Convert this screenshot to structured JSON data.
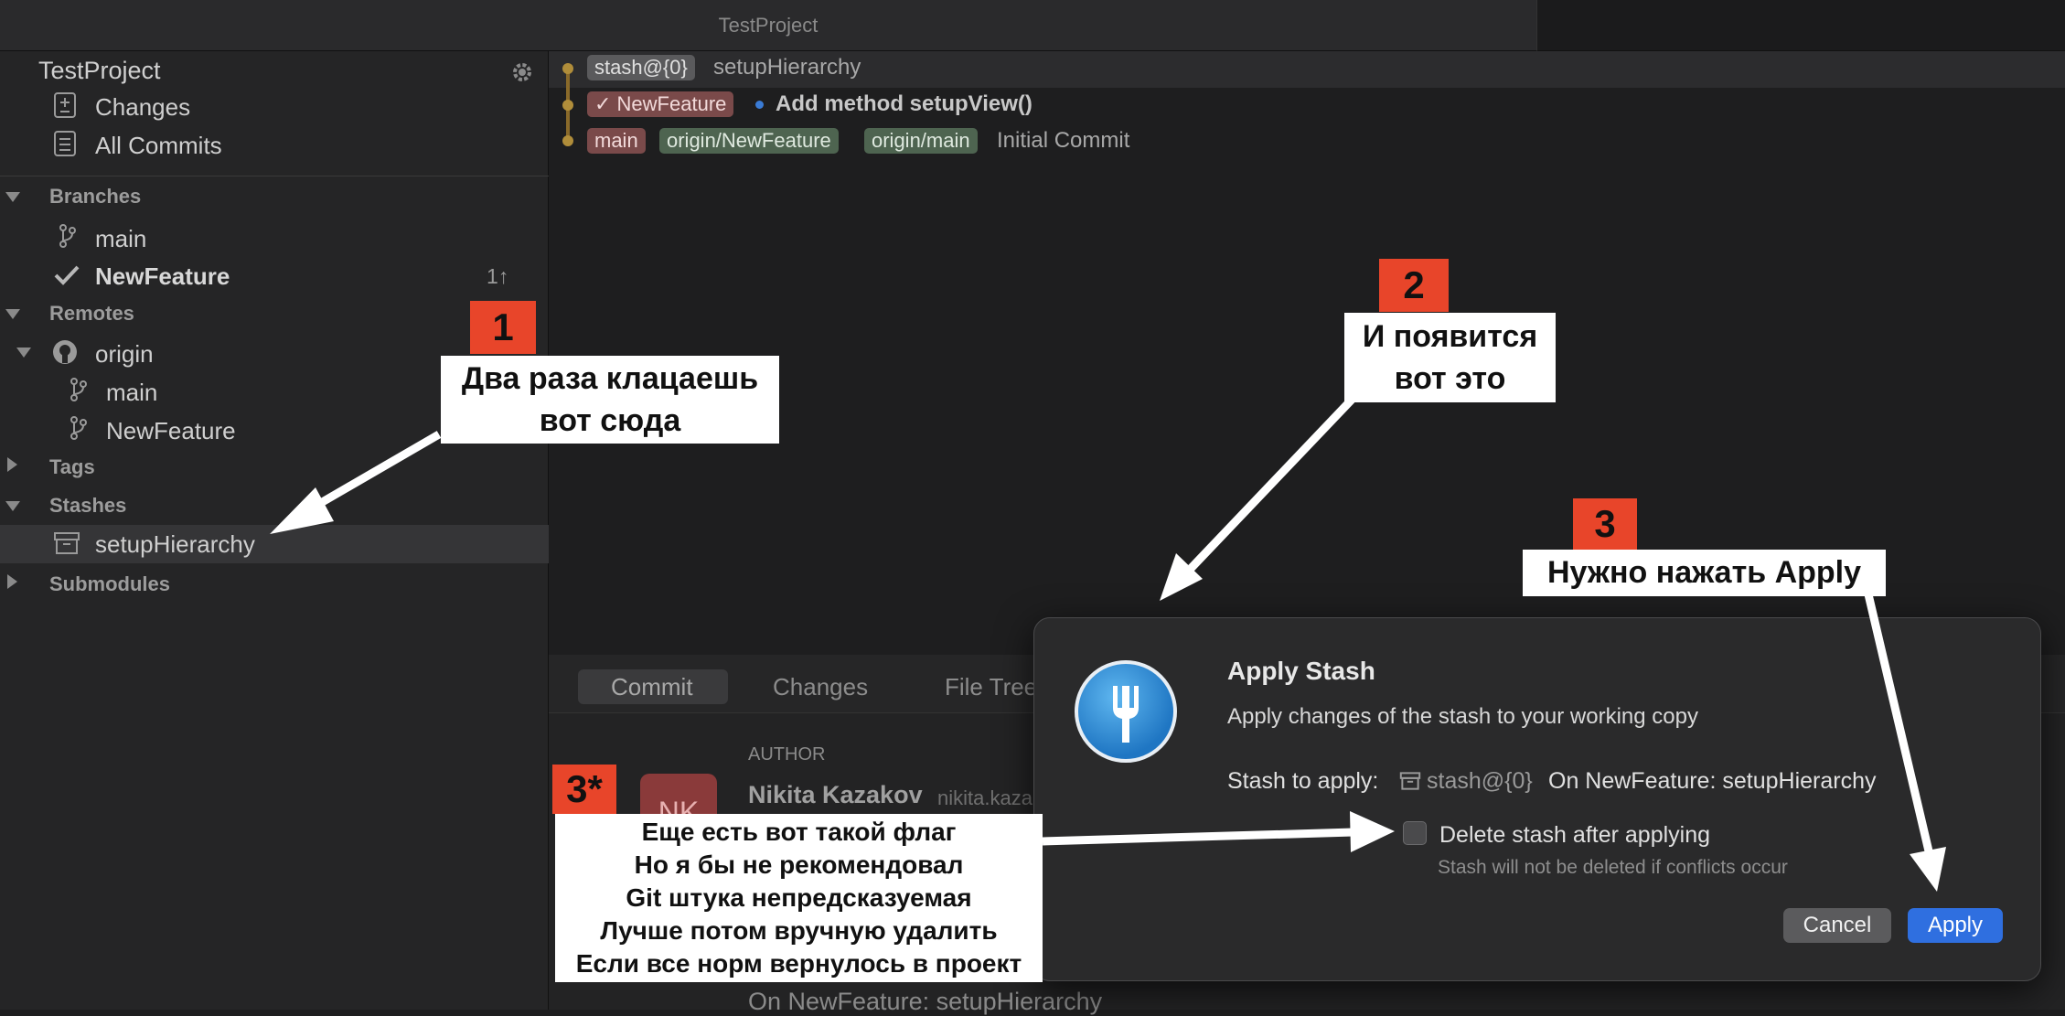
{
  "window": {
    "title": "TestProject"
  },
  "sidebar": {
    "repo_name": "TestProject",
    "nav": [
      {
        "label": "Changes",
        "icon": "changes-icon"
      },
      {
        "label": "All Commits",
        "icon": "commits-icon"
      }
    ],
    "branches_header": "Branches",
    "branches": [
      {
        "label": "main"
      },
      {
        "label": "NewFeature",
        "badge": "1↑",
        "current": true
      }
    ],
    "remotes_header": "Remotes",
    "remote_name": "origin",
    "remote_branches": [
      {
        "label": "main"
      },
      {
        "label": "NewFeature"
      }
    ],
    "tags_header": "Tags",
    "stashes_header": "Stashes",
    "stashes": [
      {
        "label": "setupHierarchy"
      }
    ],
    "submodules_header": "Submodules"
  },
  "commits": [
    {
      "tags": [
        "stash@{0}"
      ],
      "message": "setupHierarchy"
    },
    {
      "tags": [
        "✓ NewFeature"
      ],
      "message": "Add method setupView()"
    },
    {
      "tags": [
        "main",
        "origin/NewFeature",
        "origin/main"
      ],
      "message": "Initial Commit"
    }
  ],
  "detail": {
    "tabs": [
      "Commit",
      "Changes",
      "File Tree"
    ],
    "author_label": "AUTHOR",
    "author_name": "Nikita Kazakov",
    "author_email": "nikita.kaza",
    "avatar_initials": "NK",
    "footer_message": "On NewFeature: setupHierarchy"
  },
  "dialog": {
    "title": "Apply Stash",
    "subtitle": "Apply changes of the stash to your working copy",
    "stash_label": "Stash to apply:",
    "stash_ref": "stash@{0}",
    "stash_desc": "On NewFeature: setupHierarchy",
    "checkbox_label": "Delete stash after applying",
    "checkbox_checked": false,
    "checkbox_hint": "Stash will not be deleted if conflicts occur",
    "cancel_label": "Cancel",
    "apply_label": "Apply"
  },
  "annotations": {
    "a1_num": "1",
    "a1_line1": "Два раза клацаешь",
    "a1_line2": "вот сюда",
    "a2_num": "2",
    "a2_line1": "И появится",
    "a2_line2": "вот это",
    "a3_num": "3",
    "a3_text": "Нужно нажать Apply",
    "a3s_num": "3*",
    "a3s_lines": [
      "Еще есть вот такой флаг",
      "Но я бы не рекомендовал",
      "Git штука непредсказуемая",
      "Лучше потом вручную удалить",
      "Если все норм вернулось в проект"
    ]
  },
  "colors": {
    "accent": "#2f6fe0",
    "annotation": "#e8452a"
  }
}
